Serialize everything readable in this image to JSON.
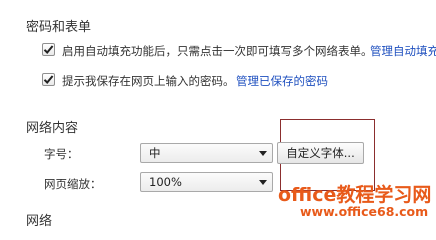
{
  "autofill_section": {
    "title": "密码和表单",
    "autofill_setting": {
      "checked": true,
      "text": "启用自动填充功能后，只需点击一次即可填写多个网络表单。",
      "link": "管理自动填充"
    },
    "password_setting": {
      "checked": true,
      "text": "提示我保存在网页上输入的密码。",
      "link": "管理已保存的密码"
    }
  },
  "web_content_section": {
    "title": "网络内容",
    "font_size": {
      "label": "字号：",
      "value": "中"
    },
    "customize_fonts_button": "自定义字体...",
    "page_zoom": {
      "label": "网页缩放：",
      "value": "100%"
    }
  },
  "network_section": {
    "title": "网络"
  },
  "watermark": {
    "title": "office教程学习网",
    "url": "www.office68.com"
  },
  "colors": {
    "link": "#1e4fbf",
    "highlight_border": "#8b2e2e",
    "watermark": "#e85a1a"
  }
}
